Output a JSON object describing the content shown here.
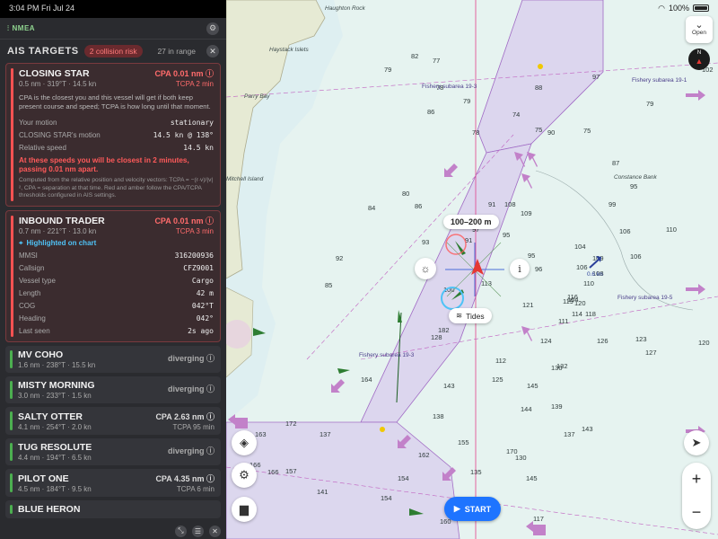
{
  "status": {
    "time": "3:04 PM",
    "date": "Fri Jul 24",
    "battery": "100%"
  },
  "panel": {
    "nmea_label": "NMEA",
    "title": "AIS TARGETS",
    "risk_badge": "2 collision risk",
    "range_count": "27 in range"
  },
  "targets": [
    {
      "name": "CLOSING STAR",
      "cpa": "CPA 0.01 nm",
      "sub": "0.5 nm · 319°T · 14.5 kn",
      "tcpa": "TCPA 2 min",
      "explanation": "CPA is the closest you and this vessel will get if both keep present course and speed; TCPA is how long until that moment.",
      "rows": [
        {
          "k": "Your motion",
          "v": "stationary"
        },
        {
          "k": "CLOSING STAR's motion",
          "v": "14.5 kn @ 138°"
        },
        {
          "k": "Relative speed",
          "v": "14.5 kn"
        }
      ],
      "warning": "At these speeds you will be closest in 2 minutes, passing 0.01 nm apart.",
      "fine": "Computed from the relative position and velocity vectors: TCPA = −(r·v)/|v|², CPA = separation at that time. Red and amber follow the CPA/TCPA thresholds configured in AIS settings."
    },
    {
      "name": "INBOUND TRADER",
      "cpa": "CPA 0.01 nm",
      "sub": "0.7 nm · 221°T · 13.0 kn",
      "tcpa": "TCPA 3 min",
      "highlight": "Highlighted on chart",
      "rows": [
        {
          "k": "MMSI",
          "v": "316200936"
        },
        {
          "k": "Callsign",
          "v": "CFZ9001"
        },
        {
          "k": "Vessel type",
          "v": "Cargo"
        },
        {
          "k": "Length",
          "v": "42 m"
        },
        {
          "k": "COG",
          "v": "042°T"
        },
        {
          "k": "Heading",
          "v": "042°"
        },
        {
          "k": "Last seen",
          "v": "2s ago"
        }
      ]
    },
    {
      "name": "MV COHO",
      "sub": "1.6 nm · 238°T · 15.5 kn",
      "status": "diverging"
    },
    {
      "name": "MISTY MORNING",
      "sub": "3.0 nm · 233°T · 1.5 kn",
      "status": "diverging"
    },
    {
      "name": "SALTY OTTER",
      "sub": "4.1 nm · 254°T · 2.0 kn",
      "cpa": "CPA 2.63 nm",
      "tcpa": "TCPA 95 min"
    },
    {
      "name": "TUG RESOLUTE",
      "sub": "4.4 nm · 194°T · 6.5 kn",
      "status": "diverging"
    },
    {
      "name": "PILOT ONE",
      "sub": "4.5 nm · 184°T · 9.5 kn",
      "cpa": "CPA 4.35 nm",
      "tcpa": "TCPA 6 min"
    },
    {
      "name": "BLUE HERON"
    }
  ],
  "map": {
    "open_label": "Open",
    "range_label": "100–200 m",
    "tides_label": "Tides",
    "start_label": "START",
    "speed_label": "0.6 kn",
    "compass_label": "N",
    "labels": {
      "rock": "Haughton Rock",
      "islets": "Haystack Islets",
      "bay": "Parry Bay",
      "island": "Mitchell Island",
      "bank": "Constance Bank",
      "subarea1": "Fishery subarea 19-3",
      "subarea2": "Fishery subarea 19-1",
      "subarea3": "Fishery subarea 19-5",
      "subarea4": "Fishery subarea 19-3"
    },
    "soundings": [
      [
        "79",
        176,
        80
      ],
      [
        "77",
        230,
        70
      ],
      [
        "78",
        234,
        100
      ],
      [
        "82",
        206,
        65
      ],
      [
        "86",
        224,
        127
      ],
      [
        "79",
        264,
        115
      ],
      [
        "78",
        274,
        150
      ],
      [
        "74",
        319,
        130
      ],
      [
        "75",
        344,
        147
      ],
      [
        "75",
        398,
        148
      ],
      [
        "79",
        468,
        118
      ],
      [
        "80",
        514,
        44
      ],
      [
        "88",
        344,
        100
      ],
      [
        "90",
        358,
        150
      ],
      [
        "97",
        408,
        88
      ],
      [
        "102",
        530,
        80
      ],
      [
        "87",
        430,
        184
      ],
      [
        "95",
        450,
        210
      ],
      [
        "99",
        426,
        230
      ],
      [
        "104",
        388,
        277
      ],
      [
        "106",
        438,
        260
      ],
      [
        "106",
        450,
        288
      ],
      [
        "106",
        390,
        300
      ],
      [
        "110",
        398,
        318
      ],
      [
        "113",
        284,
        318
      ],
      [
        "121",
        330,
        342
      ],
      [
        "124",
        350,
        382
      ],
      [
        "126",
        413,
        382
      ],
      [
        "130",
        362,
        412
      ],
      [
        "132",
        368,
        410
      ],
      [
        "139",
        362,
        455
      ],
      [
        "143",
        396,
        480
      ],
      [
        "137",
        376,
        486
      ],
      [
        "144",
        328,
        458
      ],
      [
        "145",
        335,
        432
      ],
      [
        "110",
        490,
        258
      ],
      [
        "128",
        228,
        378
      ],
      [
        "125",
        296,
        425
      ],
      [
        "138",
        230,
        466
      ],
      [
        "164",
        150,
        425
      ],
      [
        "155",
        258,
        495
      ],
      [
        "162",
        214,
        509
      ],
      [
        "166",
        26,
        520
      ],
      [
        "157",
        66,
        527
      ],
      [
        "154",
        172,
        557
      ],
      [
        "154",
        191,
        535
      ],
      [
        "135",
        272,
        528
      ],
      [
        "145",
        334,
        535
      ],
      [
        "141",
        101,
        550
      ],
      [
        "130",
        322,
        512
      ],
      [
        "143",
        242,
        432
      ],
      [
        "170",
        312,
        505
      ],
      [
        "182",
        236,
        370
      ],
      [
        "111",
        370,
        360
      ],
      [
        "114",
        385,
        352
      ],
      [
        "119",
        375,
        338
      ],
      [
        "116",
        380,
        333
      ],
      [
        "120",
        388,
        340
      ],
      [
        "108",
        408,
        307
      ],
      [
        "109",
        408,
        290
      ],
      [
        "112",
        300,
        404
      ],
      [
        "109",
        328,
        240
      ],
      [
        "108",
        310,
        230
      ],
      [
        "101",
        268,
        245
      ],
      [
        "100",
        242,
        325
      ],
      [
        "97",
        274,
        258
      ],
      [
        "91",
        292,
        230
      ],
      [
        "91",
        266,
        270
      ],
      [
        "95",
        336,
        287
      ],
      [
        "95",
        308,
        264
      ],
      [
        "96",
        344,
        302
      ],
      [
        "86",
        210,
        232
      ],
      [
        "84",
        158,
        234
      ],
      [
        "80",
        196,
        218
      ],
      [
        "85",
        110,
        320
      ],
      [
        "93",
        218,
        272
      ],
      [
        "92",
        122,
        290
      ],
      [
        "104",
        380,
        336
      ],
      [
        "118",
        400,
        352
      ],
      [
        "123",
        456,
        380
      ],
      [
        "127",
        467,
        395
      ],
      [
        "120",
        526,
        384
      ],
      [
        "117",
        342,
        580
      ],
      [
        "158",
        260,
        560
      ],
      [
        "160",
        238,
        583
      ],
      [
        "151",
        252,
        576
      ],
      [
        "137",
        104,
        486
      ],
      [
        "172",
        66,
        474
      ],
      [
        "163",
        32,
        486
      ],
      [
        "166",
        46,
        528
      ]
    ]
  }
}
